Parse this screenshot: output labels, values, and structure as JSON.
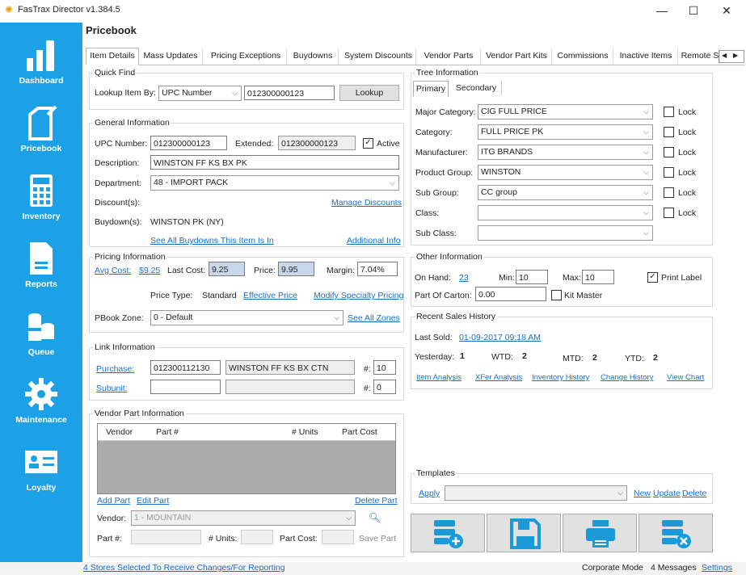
{
  "window": {
    "title": "FasTrax Director v1.384.5"
  },
  "sidebar": [
    {
      "label": "Dashboard",
      "icon": "bar-chart-icon"
    },
    {
      "label": "Pricebook",
      "icon": "document-edit-icon"
    },
    {
      "label": "Inventory",
      "icon": "calculator-icon"
    },
    {
      "label": "Reports",
      "icon": "report-icon"
    },
    {
      "label": "Queue",
      "icon": "database-icon"
    },
    {
      "label": "Maintenance",
      "icon": "gear-icon"
    },
    {
      "label": "Loyalty",
      "icon": "id-card-icon"
    }
  ],
  "page_title": "Pricebook",
  "tabs": [
    "Item Details",
    "Mass Updates",
    "Pricing Exceptions",
    "Buydowns",
    "System Discounts",
    "Vendor Parts",
    "Vendor Part Kits",
    "Commissions",
    "Inactive Items",
    "Remote S"
  ],
  "quick_find": {
    "legend": "Quick Find",
    "lookup_by_label": "Lookup Item By:",
    "lookup_by_value": "UPC Number",
    "lookup_value": "012300000123",
    "lookup_button": "Lookup"
  },
  "general": {
    "legend": "General Information",
    "upc_label": "UPC Number:",
    "upc_value": "012300000123",
    "extended_label": "Extended:",
    "extended_value": "012300000123",
    "active_label": "Active",
    "description_label": "Description:",
    "description_value": "WINSTON FF KS BX PK",
    "department_label": "Department:",
    "department_value": "48 - IMPORT PACK",
    "discounts_label": "Discount(s):",
    "manage_discounts": "Manage Discounts",
    "buydowns_label": "Buydown(s):",
    "buydowns_value": "WINSTON PK (NY)",
    "see_all_buydowns": "See All Buydowns This Item Is In",
    "additional_info": "Additional Info"
  },
  "pricing": {
    "legend": "Pricing Information",
    "avg_cost_label": "Avg Cost:",
    "avg_cost_value": "$9.25",
    "last_cost_label": "Last Cost:",
    "last_cost_value": "9.25",
    "price_label": "Price:",
    "price_value": "9.95",
    "margin_label": "Margin:",
    "margin_value": "7.04%",
    "price_type_label": "Price Type:",
    "price_type_value": "Standard",
    "effective_price": "Effective Price",
    "modify_specialty": "Modify Specialty Pricing",
    "pbook_zone_label": "PBook Zone:",
    "pbook_zone_value": "0 - Default",
    "see_all_zones": "See All Zones"
  },
  "link": {
    "legend": "Link Information",
    "purchase_label": "Purchase:",
    "purchase_upc": "012300112130",
    "purchase_desc": "WINSTON FF KS BX CTN",
    "purchase_qty_label": "#:",
    "purchase_qty": "10",
    "subunit_label": "Subunit:",
    "subunit_qty_label": "#:",
    "subunit_qty": "0"
  },
  "vendor_part": {
    "legend": "Vendor Part Information",
    "columns": [
      "Vendor",
      "Part #",
      "# Units",
      "Part Cost"
    ],
    "add_part": "Add Part",
    "edit_part": "Edit Part",
    "delete_part": "Delete Part",
    "vendor_label": "Vendor:",
    "vendor_value": "1 - MOUNTAIN",
    "part_label": "Part #:",
    "units_label": "# Units:",
    "cost_label": "Part Cost:",
    "save_part": "Save Part"
  },
  "tree": {
    "legend": "Tree Information",
    "subtabs": [
      "Primary",
      "Secondary"
    ],
    "rows": [
      {
        "label": "Major Category:",
        "value": "CIG FULL PRICE",
        "lock": "Lock"
      },
      {
        "label": "Category:",
        "value": "FULL PRICE PK",
        "lock": "Lock"
      },
      {
        "label": "Manufacturer:",
        "value": "ITG BRANDS",
        "lock": "Lock"
      },
      {
        "label": "Product Group:",
        "value": "WINSTON",
        "lock": "Lock"
      },
      {
        "label": "Sub Group:",
        "value": "CC group",
        "lock": "Lock"
      },
      {
        "label": "Class:",
        "value": "",
        "lock": "Lock"
      },
      {
        "label": "Sub Class:",
        "value": "",
        "lock": ""
      }
    ]
  },
  "other": {
    "legend": "Other Information",
    "on_hand_label": "On Hand:",
    "on_hand_value": "23",
    "min_label": "Min:",
    "min_value": "10",
    "max_label": "Max:",
    "max_value": "10",
    "print_label": "Print Label",
    "part_of_carton_label": "Part Of Carton:",
    "part_of_carton_value": "0.00",
    "kit_master": "Kit Master"
  },
  "sales": {
    "legend": "Recent Sales History",
    "last_sold_label": "Last Sold:",
    "last_sold_value": "01-09-2017 09:18 AM",
    "yesterday_label": "Yesterday:",
    "yesterday_value": "1",
    "wtd_label": "WTD:",
    "wtd_value": "2",
    "mtd_label": "MTD:",
    "mtd_value": "2",
    "ytd_label": "YTD:",
    "ytd_value": "2",
    "links": [
      "Item Analysis",
      "XFer Analysis",
      "Inventory History",
      "Change History",
      "View Chart"
    ]
  },
  "templates": {
    "legend": "Templates",
    "apply": "Apply",
    "new": "New",
    "update": "Update",
    "delete": "Delete"
  },
  "actions": [
    {
      "name": "add-record-button",
      "icon": "database-add-icon"
    },
    {
      "name": "save-button",
      "icon": "floppy-disk-icon"
    },
    {
      "name": "print-button",
      "icon": "printer-icon"
    },
    {
      "name": "delete-record-button",
      "icon": "database-delete-icon"
    }
  ],
  "status": {
    "stores_link": "4 Stores Selected To Receive Changes/For Reporting",
    "mode": "Corporate Mode",
    "messages": "4 Messages",
    "settings": "Settings"
  },
  "colors": {
    "sidebar": "#1da1e6",
    "link": "#1a6ec8",
    "action_icon": "#1a9ad8"
  }
}
